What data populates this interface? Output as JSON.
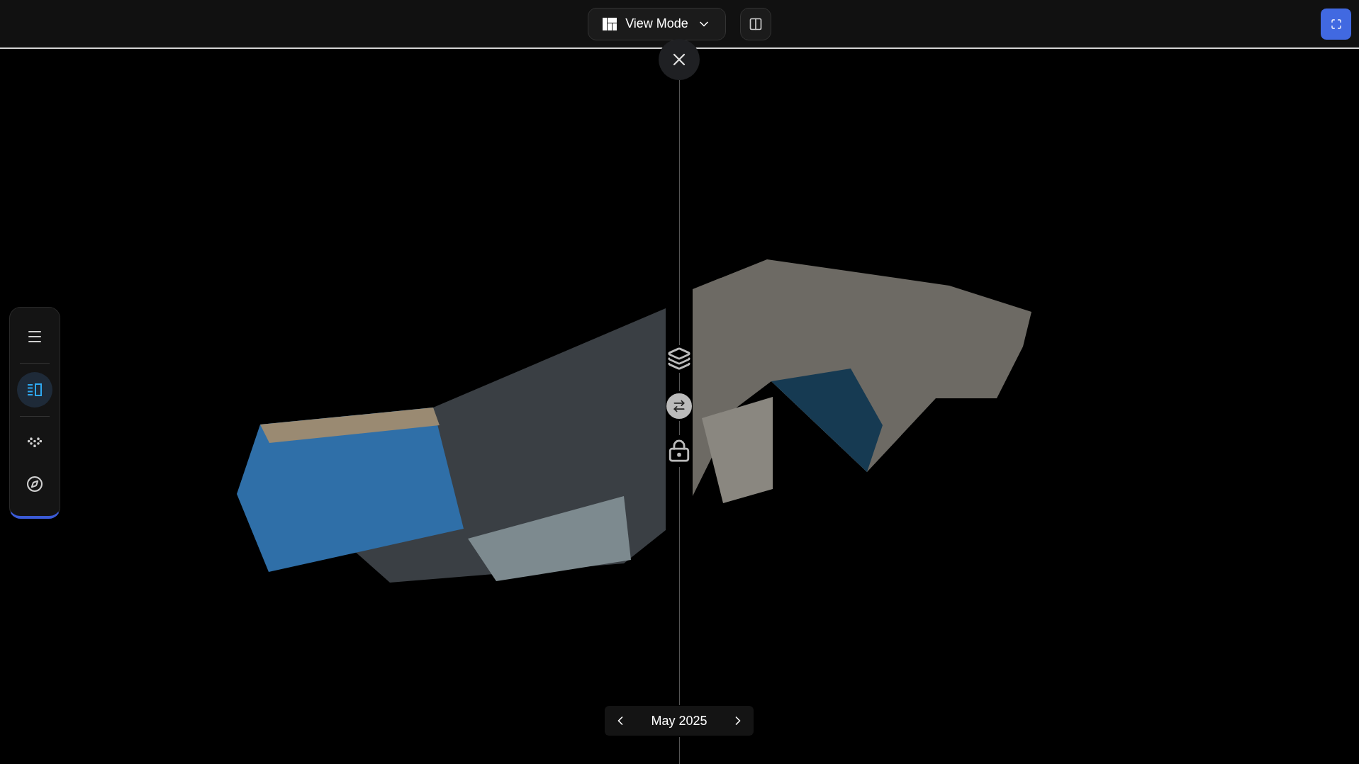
{
  "toolbar": {
    "view_mode": {
      "label": "View Mode"
    }
  },
  "sidebar": {
    "items": [
      {
        "kind": "menu",
        "selected": false
      },
      {
        "kind": "split",
        "selected": true
      },
      {
        "kind": "points",
        "selected": false
      },
      {
        "kind": "compass",
        "selected": false
      }
    ]
  },
  "date_nav": {
    "label": "May 2025"
  }
}
